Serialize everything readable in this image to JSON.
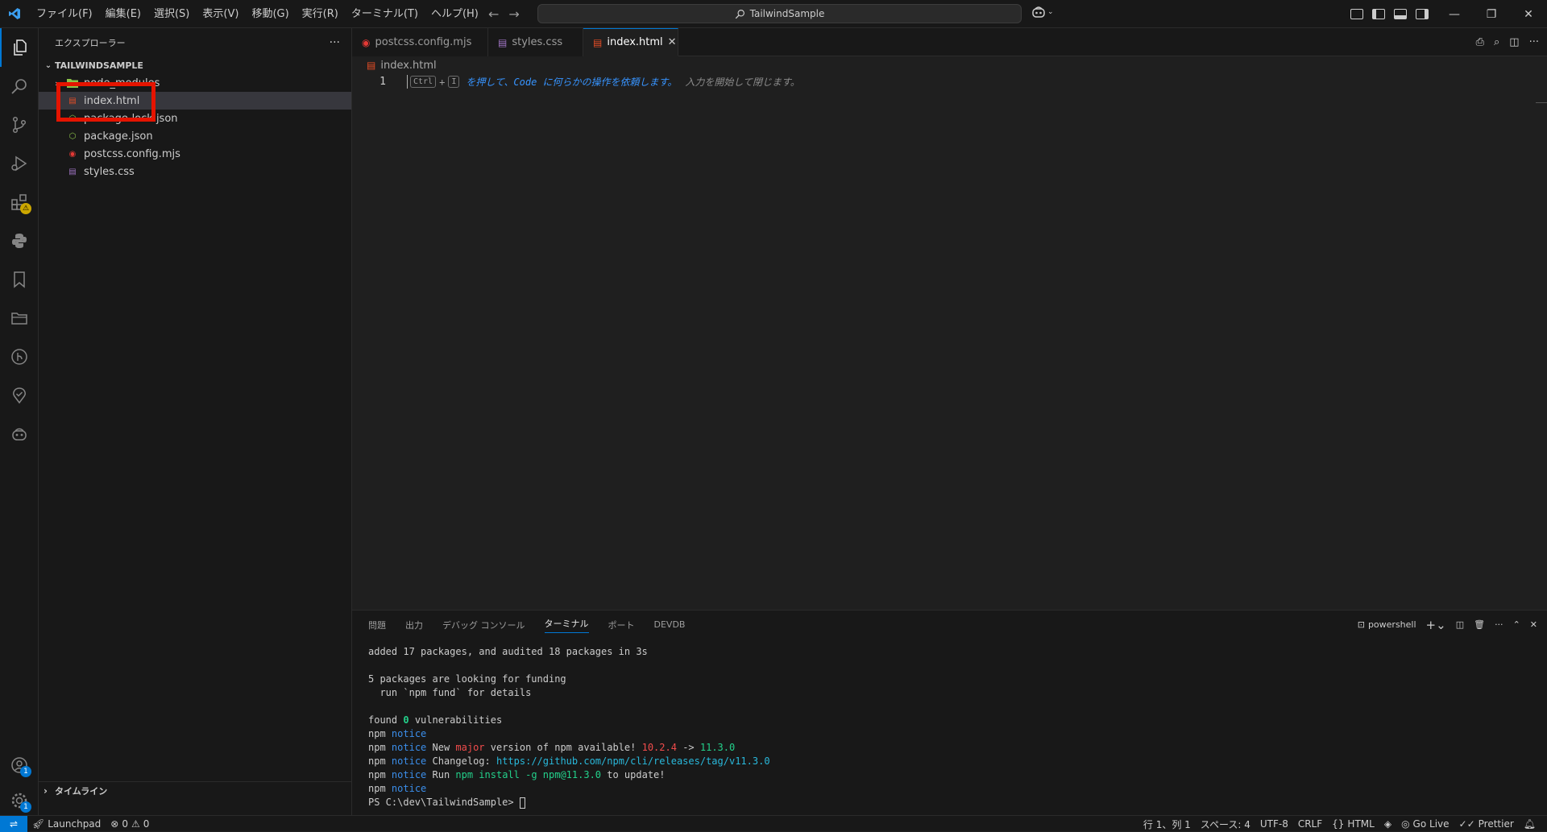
{
  "titlebar": {
    "menus": [
      "ファイル(F)",
      "編集(E)",
      "選択(S)",
      "表示(V)",
      "移動(G)",
      "実行(R)",
      "ターミナル(T)",
      "ヘルプ(H)"
    ],
    "search_text": "TailwindSample"
  },
  "sidebar": {
    "title": "エクスプローラー",
    "more": "···",
    "project": "TAILWINDSAMPLE",
    "files": [
      {
        "name": "node_modules",
        "type": "folder"
      },
      {
        "name": "index.html",
        "type": "html"
      },
      {
        "name": "package-lock.json",
        "type": "json"
      },
      {
        "name": "package.json",
        "type": "json"
      },
      {
        "name": "postcss.config.mjs",
        "type": "mjs"
      },
      {
        "name": "styles.css",
        "type": "css"
      }
    ],
    "timeline": "タイムライン"
  },
  "editor": {
    "tabs": [
      {
        "label": "postcss.config.mjs"
      },
      {
        "label": "styles.css"
      },
      {
        "label": "index.html"
      }
    ],
    "breadcrumb": "index.html",
    "line_number": "1",
    "hint": {
      "key1": "Ctrl",
      "plus": "+",
      "key2": "I",
      "text_blue": "を押して、Code に何らかの操作を依頼します。",
      "text_gray": "入力を開始して閉じます。"
    }
  },
  "panel": {
    "tabs": [
      "問題",
      "出力",
      "デバッグ コンソール",
      "ターミナル",
      "ポート",
      "DEVDB"
    ],
    "shell": "powershell",
    "terminal": {
      "l1": "added 17 packages, and audited 18 packages in 3s",
      "l2": "5 packages are looking for funding",
      "l3": "  run `npm fund` for details",
      "l4a": "found ",
      "l4b": "0",
      "l4c": " vulnerabilities",
      "npm": "npm",
      "notice": "notice",
      "l6a": " New ",
      "l6b": "major",
      "l6c": " version of npm available! ",
      "l6d": "10.2.4",
      "l6e": " -> ",
      "l6f": "11.3.0",
      "l7a": " Changelog: ",
      "l7b": "https://github.com/npm/cli/releases/tag/v11.3.0",
      "l8a": " Run ",
      "l8b": "npm install -g npm@11.3.0",
      "l8c": " to update!",
      "prompt": "PS C:\\dev\\TailwindSample> "
    }
  },
  "statusbar": {
    "launchpad": "Launchpad",
    "errors": "0",
    "warnings": "0",
    "position": "行 1、列 1",
    "spaces": "スペース: 4",
    "encoding": "UTF-8",
    "eol": "CRLF",
    "language": "HTML",
    "golive": "Go Live",
    "prettier": "Prettier"
  },
  "badges": {
    "accounts": "1",
    "settings": "1"
  }
}
